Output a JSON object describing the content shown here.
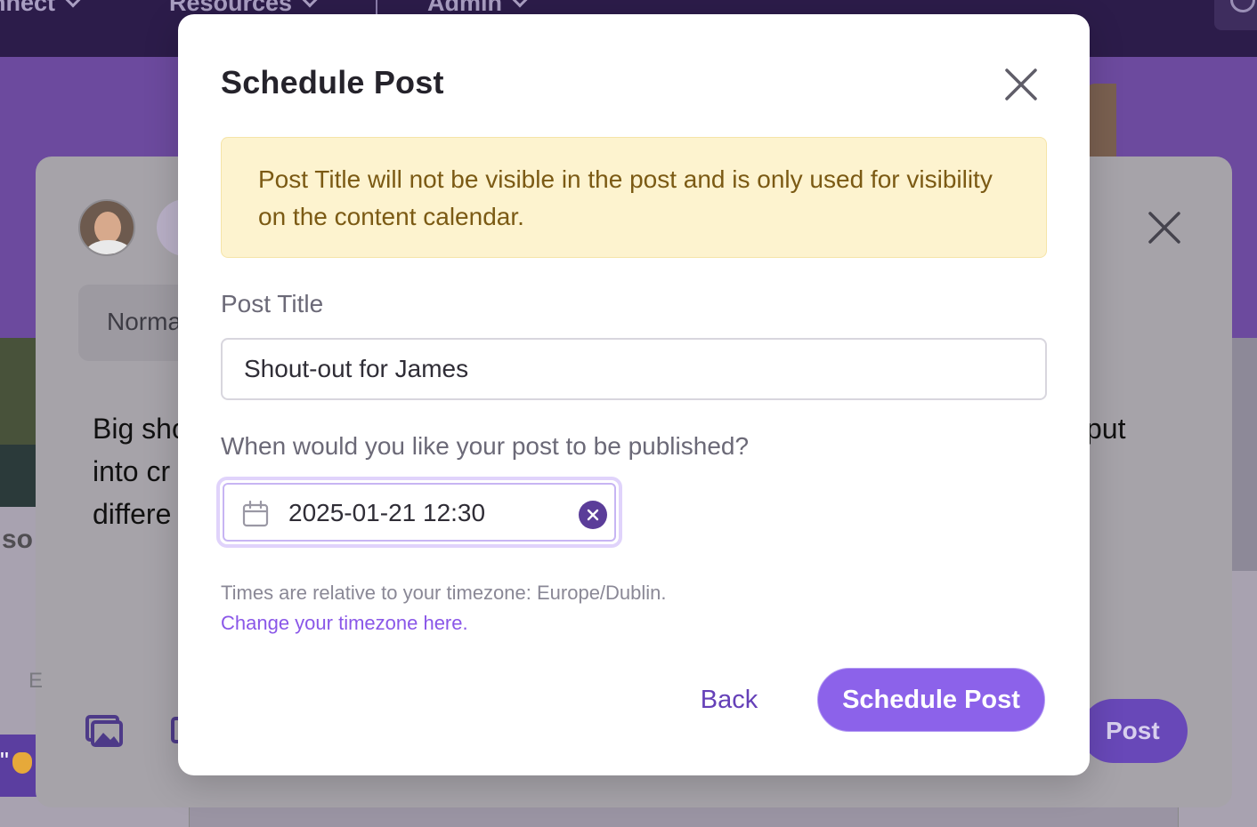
{
  "background": {
    "nav_items": [
      "nnect",
      "Resources",
      "Admin"
    ],
    "composer": {
      "format_label": "Norma",
      "text_lines": [
        "Big sho",
        "into cr",
        "differe"
      ],
      "text_right": "put",
      "side_text": "so",
      "faint_text": "E",
      "side_badge_text": "\"",
      "post_label": "Post"
    }
  },
  "modal": {
    "title": "Schedule Post",
    "alert_text": "Post Title will not be visible in the post and is only used for visibility on the content calendar.",
    "post_title_label": "Post Title",
    "post_title_value": "Shout-out for James",
    "when_label": "When would you like your post to be published?",
    "datetime_value": "2025-01-21 12:30",
    "timezone_note": "Times are relative to your timezone: Europe/Dublin.",
    "timezone_link": "Change your timezone here.",
    "back_label": "Back",
    "schedule_label": "Schedule Post"
  },
  "colors": {
    "accent": "#8c62ea",
    "accent_dark": "#5b3d99",
    "alert_bg": "#fdf3cf",
    "alert_text": "#7b5a14",
    "link": "#8a57e8"
  },
  "icons": [
    "close-icon",
    "calendar-icon",
    "clear-icon",
    "chevron-down-icon",
    "search-icon",
    "gallery-icon"
  ]
}
